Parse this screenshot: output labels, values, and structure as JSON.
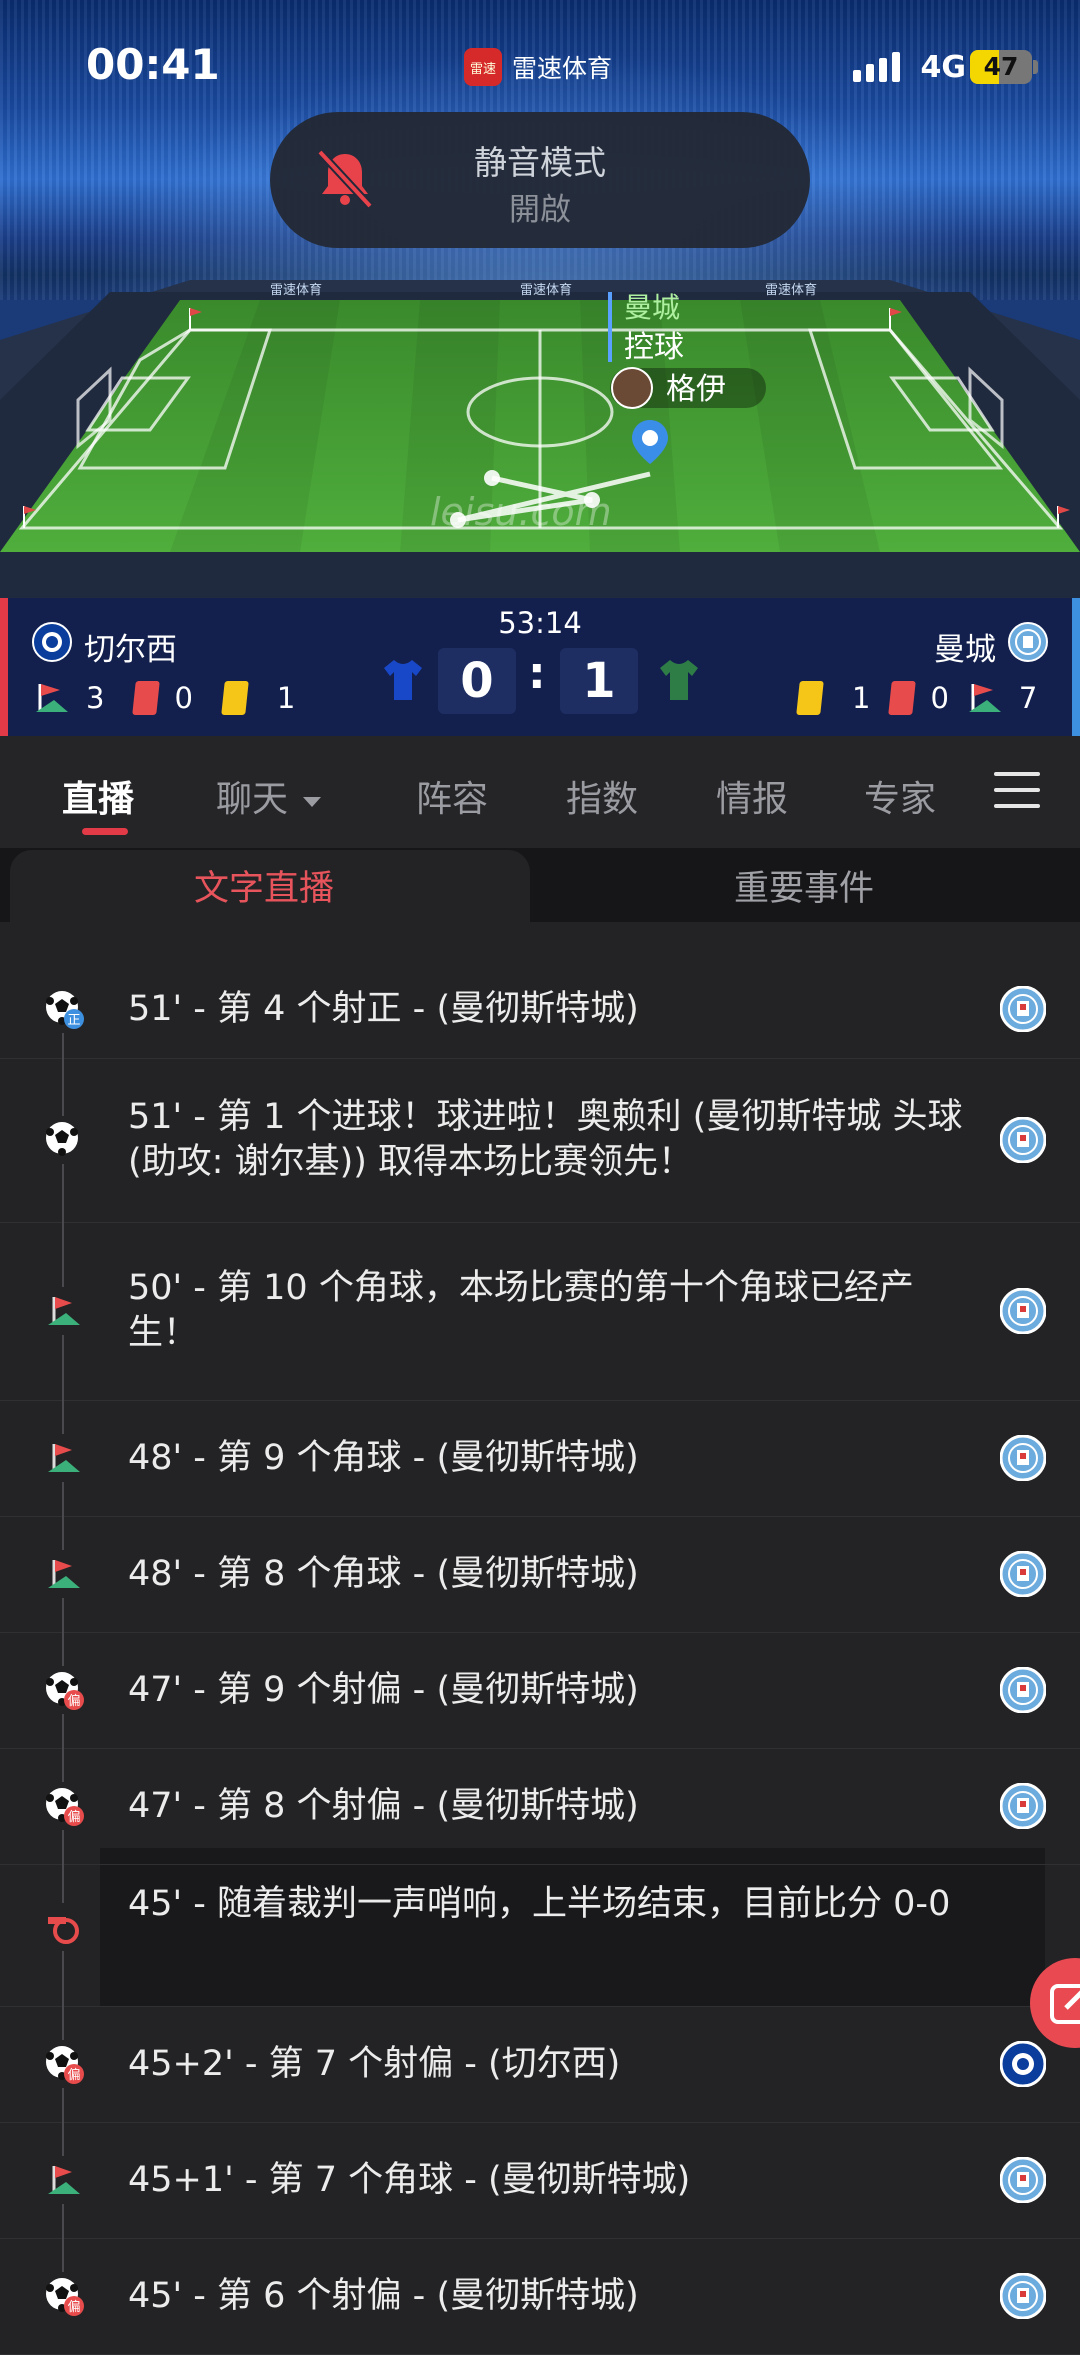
{
  "status_bar": {
    "time": "00:41",
    "app_name": "雷速体育",
    "app_logo_text": "雷速",
    "network": "4G",
    "battery_level": "47",
    "battery_fraction": 0.47
  },
  "notice": {
    "line1": "静音模式",
    "line2": "開啟"
  },
  "field": {
    "possession_team": "曼城",
    "possession_label": "控球",
    "player_name": "格伊",
    "watermark": "leisu.com",
    "board_text": "雷速体育"
  },
  "scoreboard": {
    "clock": "53:14",
    "home": {
      "name": "切尔西",
      "goals": "0",
      "corners": "3",
      "red_cards": "0",
      "yellow_cards": "1"
    },
    "away": {
      "name": "曼城",
      "goals": "1",
      "corners": "7",
      "red_cards": "0",
      "yellow_cards": "1"
    },
    "colon": ":"
  },
  "tabs": [
    "直播",
    "聊天",
    "阵容",
    "指数",
    "情报",
    "专家"
  ],
  "active_tab": "直播",
  "subtabs": [
    "文字直播",
    "重要事件"
  ],
  "feed": [
    {
      "icon": "shot-on-target-icon",
      "badge": "正",
      "text": "51' - 第 4 个射正 - (曼彻斯特城)",
      "team": "mancity"
    },
    {
      "icon": "goal-icon",
      "badge": "",
      "text": "51' - 第 1 个进球！球进啦！奥赖利 (曼彻斯特城 头球 (助攻: 谢尔基)) 取得本场比赛领先！",
      "team": "mancity"
    },
    {
      "icon": "corner-flag-icon",
      "badge": "",
      "text": "50' - 第 10 个角球，本场比赛的第十个角球已经产生！",
      "team": "mancity"
    },
    {
      "icon": "corner-flag-icon",
      "badge": "",
      "text": "48' - 第 9 个角球 - (曼彻斯特城)",
      "team": "mancity"
    },
    {
      "icon": "corner-flag-icon",
      "badge": "",
      "text": "48' - 第 8 个角球 - (曼彻斯特城)",
      "team": "mancity"
    },
    {
      "icon": "shot-off-target-icon",
      "badge": "偏",
      "text": "47' - 第 9 个射偏 - (曼彻斯特城)",
      "team": "mancity"
    },
    {
      "icon": "shot-off-target-icon",
      "badge": "偏",
      "text": "47' - 第 8 个射偏 - (曼彻斯特城)",
      "team": "mancity"
    },
    {
      "icon": "whistle-icon",
      "badge": "",
      "text": "45' - 随着裁判一声哨响，上半场结束，目前比分 0-0",
      "team": ""
    },
    {
      "icon": "shot-off-target-icon",
      "badge": "偏",
      "text": "45+2' - 第 7 个射偏 - (切尔西)",
      "team": "chelsea"
    },
    {
      "icon": "corner-flag-icon",
      "badge": "",
      "text": "45+1' - 第 7 个角球 - (曼彻斯特城)",
      "team": "mancity"
    },
    {
      "icon": "shot-off-target-icon",
      "badge": "偏",
      "text": "45' - 第 6 个射偏 - (曼彻斯特城)",
      "team": "mancity"
    }
  ],
  "colors": {
    "accent_red": "#e23a47",
    "home_blue": "#1848c8",
    "away_green": "#2e7d46",
    "pitch_green": "#4aa53a",
    "bg": "#232325"
  }
}
